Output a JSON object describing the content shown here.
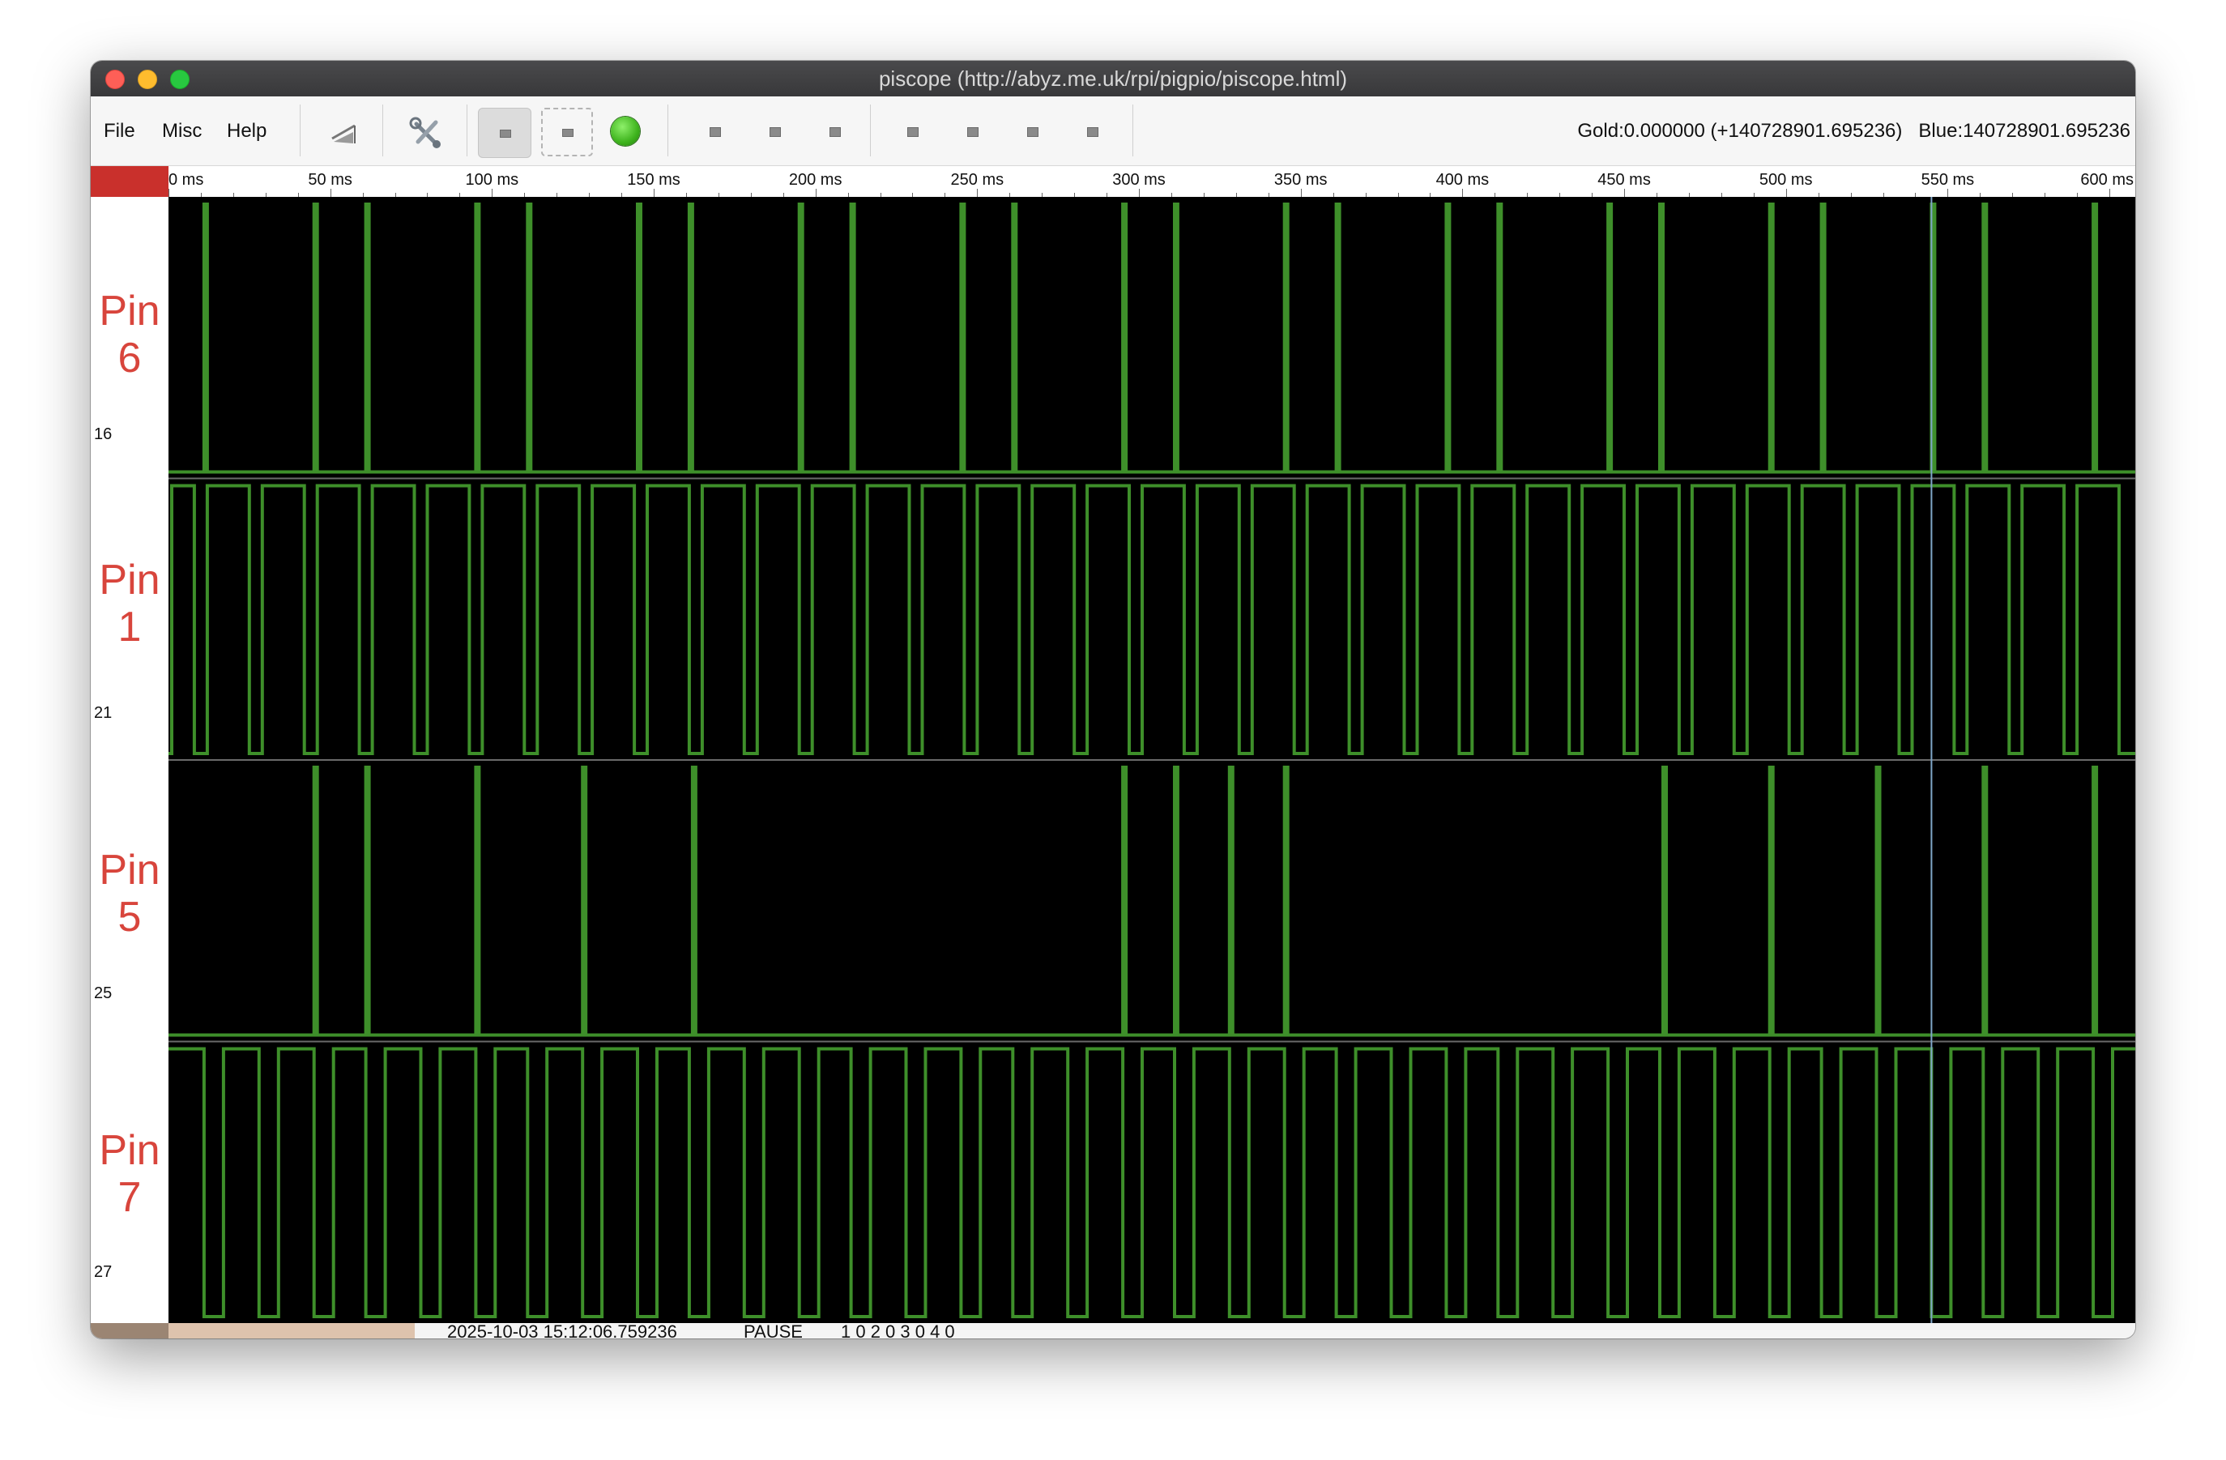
{
  "window": {
    "title": "piscope (http://abyz.me.uk/rpi/pigpio/piscope.html)"
  },
  "menu": {
    "items": [
      "File",
      "Misc",
      "Help"
    ]
  },
  "toolbar": {
    "buttons": [
      {
        "name": "trigger-button",
        "icon": "trigger-icon"
      },
      {
        "name": "settings-button",
        "icon": "tools-icon"
      },
      {
        "name": "live-mode-button",
        "icon": "square-icon",
        "state": "active"
      },
      {
        "name": "play-mode-button",
        "icon": "square-icon"
      },
      {
        "name": "run-indicator",
        "icon": "green-led-icon",
        "color": "#3eb31d"
      },
      {
        "name": "view-button-1",
        "icon": "square-icon"
      },
      {
        "name": "view-button-2",
        "icon": "square-icon"
      },
      {
        "name": "view-button-3",
        "icon": "square-icon"
      },
      {
        "name": "zoom-button-1",
        "icon": "square-icon"
      },
      {
        "name": "zoom-button-2",
        "icon": "square-icon"
      },
      {
        "name": "zoom-button-3",
        "icon": "square-icon"
      },
      {
        "name": "zoom-button-4",
        "icon": "square-icon"
      }
    ],
    "gold_readout": "Gold:0.000000 (+140728901.695236)",
    "blue_readout": "Blue:140728901.695236"
  },
  "ruler": {
    "ticks": [
      "0 ms",
      "50 ms",
      "100 ms",
      "150 ms",
      "200 ms",
      "250 ms",
      "300 ms",
      "350 ms",
      "400 ms",
      "450 ms",
      "500 ms",
      "550 ms",
      "600 ms"
    ]
  },
  "chart_data": {
    "type": "line",
    "x_unit": "ms",
    "xlim": [
      0,
      608
    ],
    "ylim": [
      0,
      1
    ],
    "background": "#000000",
    "trace_color": "#3e8f2a",
    "blue_cursor_ms": 545,
    "series": [
      {
        "name": "Pin 6",
        "gpio": "16",
        "initial": 0,
        "edges": [
          11,
          12,
          45,
          46,
          61,
          62,
          95,
          96,
          111,
          112,
          145,
          146,
          161,
          162,
          195,
          196,
          211,
          212,
          245,
          246,
          261,
          262,
          295,
          296,
          311,
          312,
          345,
          346,
          361,
          362,
          395,
          396,
          411,
          412,
          445,
          446,
          461,
          462,
          495,
          496,
          511,
          512,
          545,
          546,
          561,
          562,
          595,
          596
        ]
      },
      {
        "name": "Pin 1",
        "gpio": "21",
        "initial": 0,
        "edges": [
          1,
          8,
          12,
          25,
          29,
          42,
          46,
          59,
          63,
          76,
          80,
          93,
          97,
          110,
          114,
          127,
          131,
          144,
          148,
          161,
          165,
          178,
          182,
          195,
          199,
          212,
          216,
          229,
          233,
          246,
          250,
          263,
          267,
          280,
          284,
          297,
          301,
          314,
          318,
          331,
          335,
          348,
          352,
          365,
          369,
          382,
          386,
          399,
          403,
          416,
          420,
          433,
          437,
          450,
          454,
          467,
          471,
          484,
          488,
          501,
          505,
          518,
          522,
          535,
          539,
          552,
          556,
          569,
          573,
          586,
          590,
          603
        ]
      },
      {
        "name": "Pin 5",
        "gpio": "25",
        "initial": 0,
        "edges": [
          45,
          46,
          61,
          62,
          95,
          96,
          128,
          129,
          162,
          163,
          295,
          296,
          311,
          312,
          328,
          329,
          345,
          346,
          462,
          463,
          495,
          496,
          528,
          529,
          561,
          562,
          595,
          596
        ]
      },
      {
        "name": "Pin 7",
        "gpio": "27",
        "initial": 1,
        "edges": [
          11,
          17,
          28,
          34,
          45,
          51,
          61,
          67,
          78,
          84,
          95,
          101,
          111,
          117,
          128,
          134,
          145,
          151,
          161,
          167,
          178,
          184,
          195,
          201,
          211,
          217,
          228,
          234,
          245,
          251,
          261,
          267,
          278,
          284,
          295,
          301,
          311,
          317,
          328,
          334,
          345,
          351,
          361,
          367,
          378,
          384,
          395,
          401,
          411,
          417,
          428,
          434,
          445,
          451,
          461,
          467,
          478,
          484,
          495,
          501,
          511,
          517,
          528,
          534,
          545,
          551,
          561,
          567,
          578,
          584,
          595,
          601
        ]
      }
    ]
  },
  "status": {
    "timestamp": "2025-10-03 15:12:06.759236",
    "mode": "PAUSE",
    "counters": "1 0  2 0  3 0  4 0"
  }
}
